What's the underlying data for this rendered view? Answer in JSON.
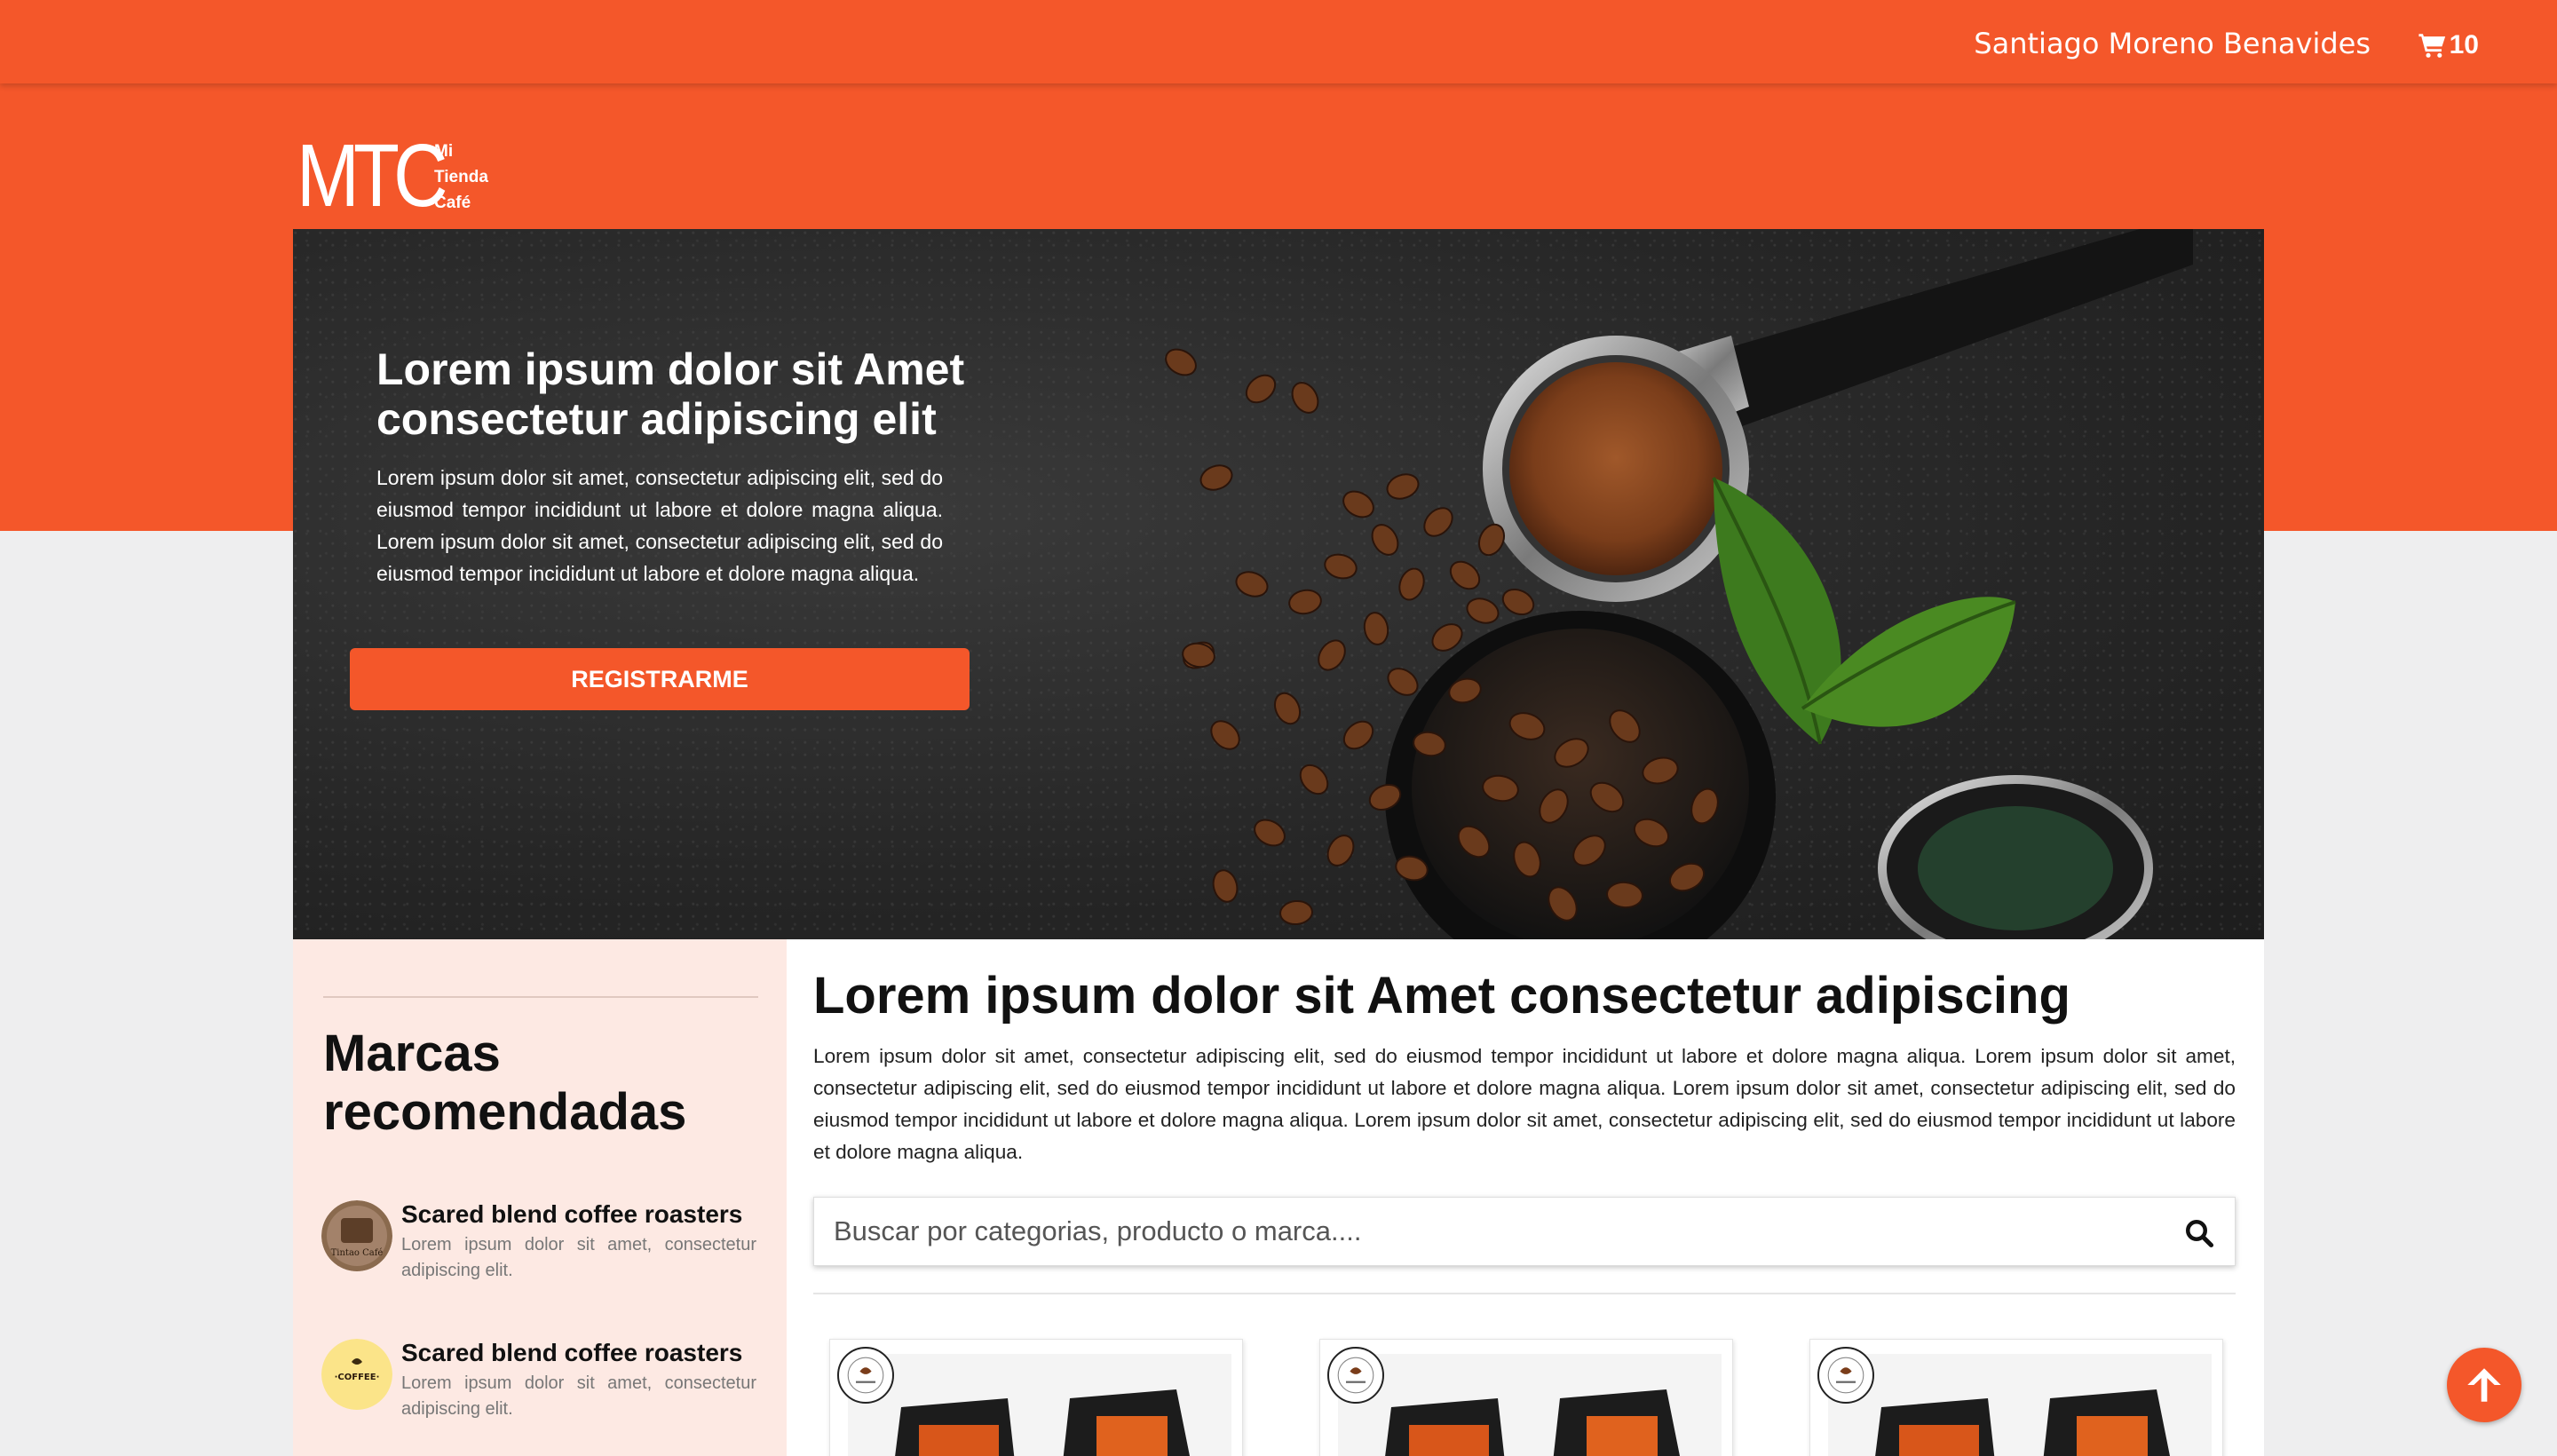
{
  "header": {
    "user_name": "Santiago Moreno Benavides",
    "cart_count": "10"
  },
  "logo": {
    "mark": "MTC",
    "line1": "Mi",
    "line2": "Tienda",
    "line3": "Café"
  },
  "hero": {
    "title": "Lorem ipsum dolor sit Amet consectetur adipiscing elit",
    "text": "Lorem ipsum dolor sit amet, consectetur adipiscing elit, sed do eiusmod tempor incididunt ut labore et dolore magna aliqua. Lorem ipsum dolor sit amet, consectetur adipiscing elit, sed do eiusmod tempor incididunt ut labore et dolore magna aliqua.",
    "button_label": "REGISTRARME"
  },
  "sidebar": {
    "title": "Marcas recomendadas",
    "brands": [
      {
        "name": "Scared blend coffee roasters",
        "desc": "Lorem ipsum dolor sit amet, consectetur adipiscing elit.",
        "logo_text": "Tintao Café"
      },
      {
        "name": "Scared blend coffee roasters",
        "desc": "Lorem ipsum dolor sit amet, consectetur adipiscing elit.",
        "logo_text": "·COFFEE·"
      }
    ]
  },
  "main": {
    "title": "Lorem ipsum dolor sit Amet consectetur adipiscing",
    "text": "Lorem ipsum dolor sit amet, consectetur adipiscing elit, sed do eiusmod tempor incididunt ut labore et dolore magna aliqua. Lorem ipsum dolor sit amet, consectetur adipiscing elit, sed do eiusmod tempor incididunt ut labore et dolore magna aliqua. Lorem ipsum dolor sit amet, consectetur adipiscing elit, sed do eiusmod tempor incididunt ut labore et dolore magna aliqua. Lorem ipsum dolor sit amet, consectetur adipiscing elit, sed do eiusmod tempor incididunt ut labore et dolore magna aliqua.",
    "search_placeholder": "Buscar por categorias, producto o marca...."
  },
  "icons": {
    "cart": "cart-icon",
    "search": "search-icon",
    "scroll_top": "arrow-up-icon"
  },
  "colors": {
    "brand": "#f4572a",
    "sidebar_bg": "#fde9e3",
    "page_bg": "#eeeeef"
  }
}
